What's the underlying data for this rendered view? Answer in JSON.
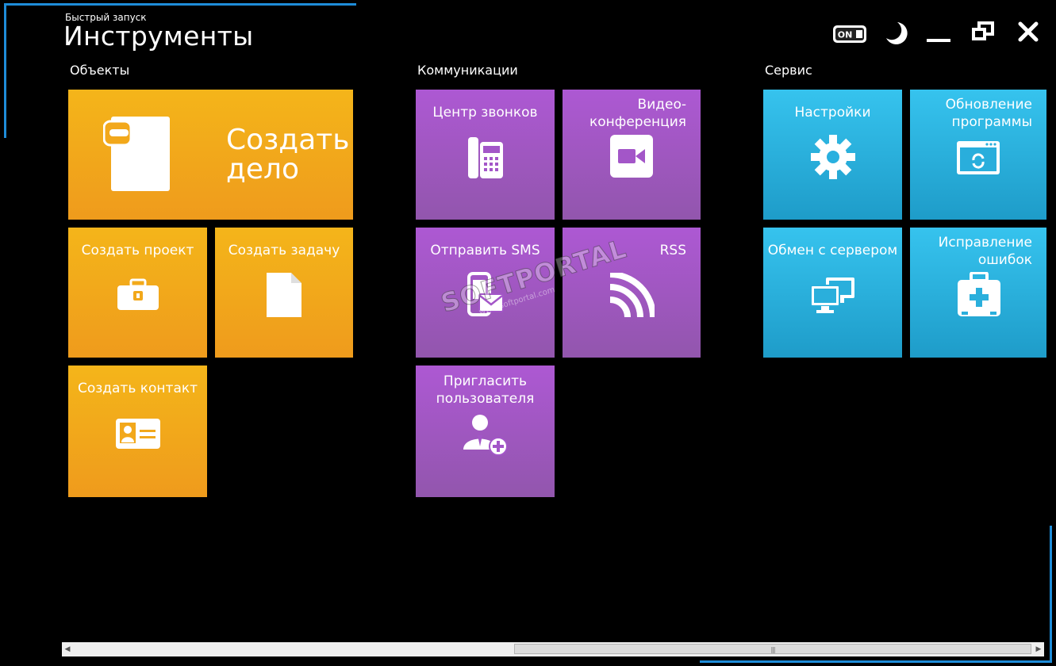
{
  "header": {
    "subtitle": "Быстрый запуск",
    "title": "Инструменты"
  },
  "sections": {
    "objects": "Объекты",
    "communications": "Коммуникации",
    "service": "Сервис"
  },
  "tiles": {
    "create_case": "Создать дело",
    "create_project": "Создать проект",
    "create_task": "Создать задачу",
    "create_contact": "Создать контакт",
    "call_center": "Центр звонков",
    "video_conference": "Видео-\nконференция",
    "send_sms": "Отправить SMS",
    "rss": "RSS",
    "invite_user": "Пригласить\nпользователя",
    "settings": "Настройки",
    "update_program": "Обновление\nпрограммы",
    "server_exchange": "Обмен с сервером",
    "fix_errors": "Исправление\nошибок"
  },
  "window_controls": {
    "toggle": "ON"
  },
  "watermark": {
    "brand": "SOFTPORTAL",
    "url": "www.softportal.com"
  },
  "colors": {
    "orange": "#f4b51a",
    "purple": "#a656cc",
    "blue": "#2bb4e2",
    "accent": "#1e8cd8"
  }
}
